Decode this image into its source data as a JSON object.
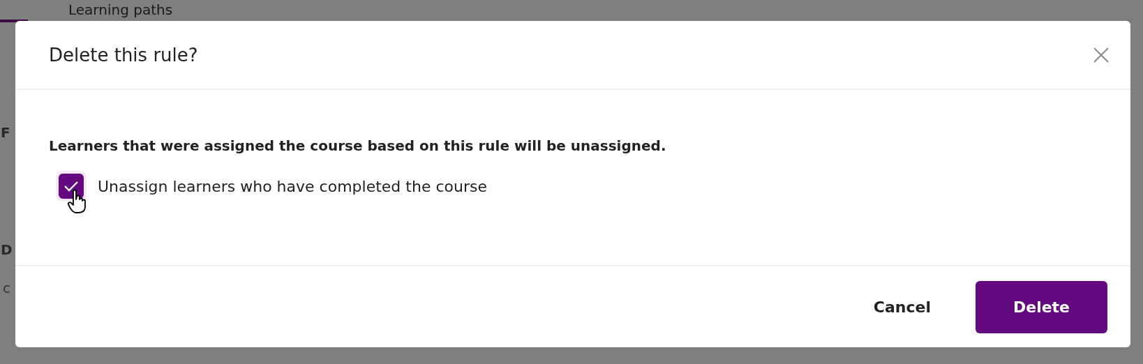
{
  "background": {
    "tab": "Learning paths",
    "fragments": [
      {
        "text": "F",
        "kind": "heading"
      },
      {
        "text": "D",
        "kind": "heading"
      },
      {
        "text": "c",
        "kind": "text"
      }
    ]
  },
  "dialog": {
    "title": "Delete this rule?",
    "message": "Learners that were assigned the course based on this rule will be unassigned.",
    "checkbox": {
      "label": "Unassign learners who have completed the course",
      "checked": true
    },
    "buttons": [
      {
        "label": "Cancel",
        "kind": "secondary"
      },
      {
        "label": "Delete",
        "kind": "primary"
      }
    ]
  }
}
